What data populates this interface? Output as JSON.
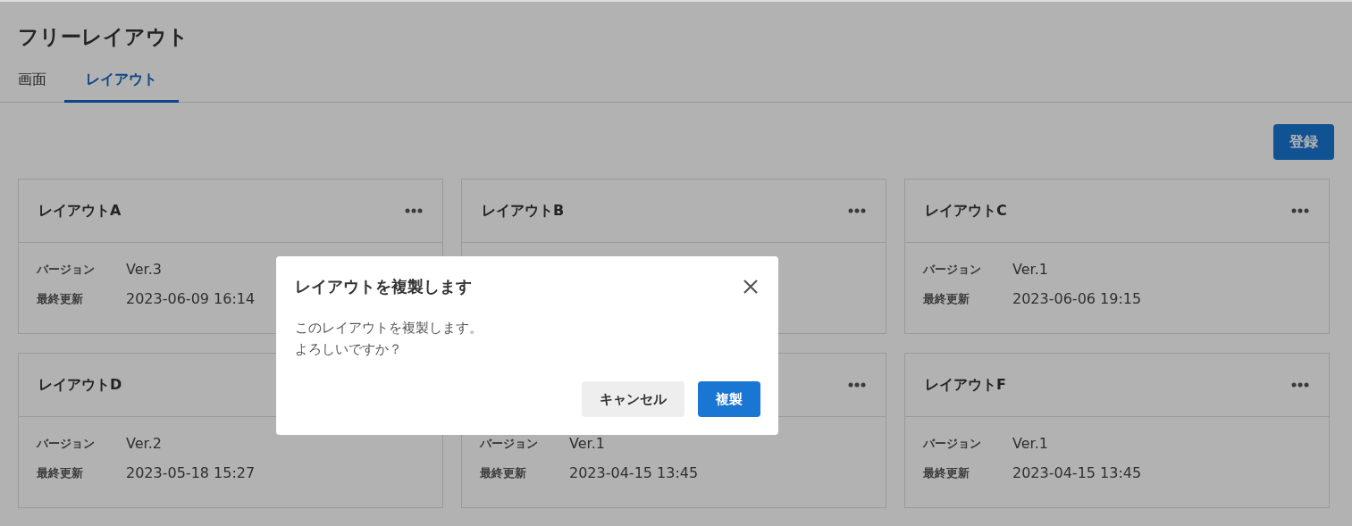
{
  "page": {
    "title": "フリーレイアウト"
  },
  "tabs": [
    {
      "label": "画面",
      "selected": false
    },
    {
      "label": "レイアウト",
      "selected": true
    }
  ],
  "register_button": "登録",
  "cards": [
    {
      "title": "レイアウトA",
      "fields": [
        {
          "label": "バージョン",
          "value": "Ver.3"
        },
        {
          "label": "最終更新",
          "value": "2023-06-09 16:14"
        }
      ]
    },
    {
      "title": "レイアウトB"
    },
    {
      "title": "レイアウトC",
      "fields": [
        {
          "label": "バージョン",
          "value": "Ver.1"
        },
        {
          "label": "最終更新",
          "value": "2023-06-06 19:15"
        }
      ]
    },
    {
      "title": "レイアウトD",
      "fields": [
        {
          "label": "バージョン",
          "value": "Ver.2"
        },
        {
          "label": "最終更新",
          "value": "2023-05-18 15:27"
        }
      ]
    },
    {
      "fields": [
        {
          "label": "バージョン",
          "value": "Ver.1"
        },
        {
          "label": "最終更新",
          "value": "2023-04-15 13:45"
        }
      ]
    },
    {
      "title": "レイアウトF",
      "fields": [
        {
          "label": "バージョン",
          "value": "Ver.1"
        },
        {
          "label": "最終更新",
          "value": "2023-04-15 13:45"
        }
      ]
    }
  ],
  "dialog": {
    "title": "レイアウトを複製します",
    "message_lines": [
      "このレイアウトを複製します。",
      "よろしいですか？"
    ],
    "cancel_button": "キャンセル",
    "confirm_button": "複製"
  }
}
